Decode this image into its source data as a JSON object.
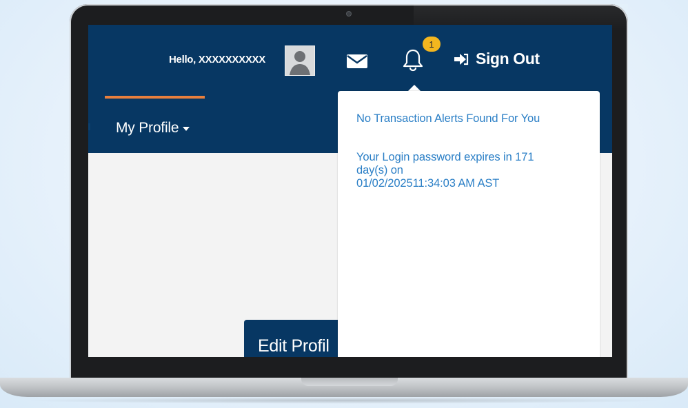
{
  "header": {
    "greeting": "Hello, XXXXXXXXXX",
    "notification_count": "1",
    "sign_out_label": "Sign Out"
  },
  "nav": {
    "my_profile_label": "My Profile"
  },
  "content": {
    "edit_profile_label": "Edit Profil"
  },
  "alerts_dropdown": {
    "no_alerts_text": "No Transaction Alerts Found For You",
    "password_line_1": "Your Login password expires in 171",
    "password_line_2": "day(s) on",
    "password_line_3": "01/02/202511:34:03 AM AST"
  },
  "icons": {
    "mail": "mail-icon",
    "bell": "bell-icon",
    "sign_out": "sign-out-icon",
    "avatar": "avatar-icon",
    "caret": "caret-down-icon"
  },
  "colors": {
    "header_bg": "#073763",
    "accent_orange": "#e87f3d",
    "badge_yellow": "#f3b61f",
    "alert_text_blue": "#2b7fc6"
  }
}
